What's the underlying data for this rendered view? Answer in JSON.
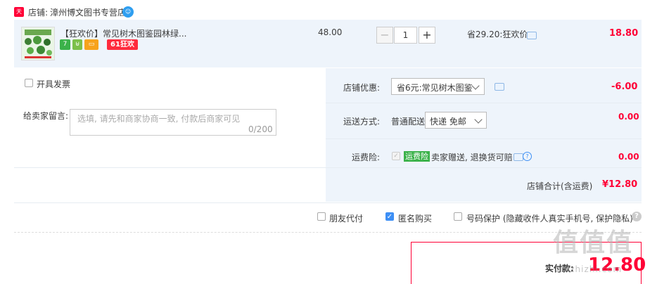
{
  "shop": {
    "badge": "天猫",
    "label": "店铺:",
    "name": "漳州博文图书专营店",
    "ww_icon": "ww-chat-icon"
  },
  "item": {
    "title": "【狂欢价】常见树木图鉴园林绿...",
    "tags": {
      "seven": "7",
      "promo": "61狂欢"
    },
    "unit_price": "48.00",
    "quantity": "1",
    "minus": "−",
    "plus": "+",
    "savings": "省29.20:狂欢价",
    "subtotal": "18.80"
  },
  "invoice": {
    "label": "开具发票"
  },
  "message": {
    "label": "给卖家留言:",
    "placeholder": "选填, 请先和商家协商一致, 付款后商家可见",
    "counter": "0/200"
  },
  "shop_discount": {
    "label": "店铺优惠:",
    "selected": "省6元:常见树木图鉴",
    "amount": "-6.00"
  },
  "shipping": {
    "label": "运送方式:",
    "method": "普通配送",
    "selected": "快递 免邮",
    "amount": "0.00"
  },
  "insurance": {
    "label": "运费险:",
    "tag": "运费险",
    "desc": "卖家赠送, 退换货可赔",
    "amount": "0.00"
  },
  "shop_total": {
    "label": "店铺合计(含运费)",
    "value": "¥12.80"
  },
  "options": {
    "friend_pay": "朋友代付",
    "anonymous": "匿名购买",
    "privacy": "号码保护 (隐藏收件人真实手机号, 保护隐私)",
    "help": "?"
  },
  "payment": {
    "label": "实付款:",
    "value": "12.80"
  },
  "watermark": {
    "logo": "值值值",
    "url": "zhizhizhi.com"
  },
  "colors": {
    "accent": "#ff0036",
    "panel": "#eef4fb",
    "checkbox": "#3d8ff5"
  }
}
